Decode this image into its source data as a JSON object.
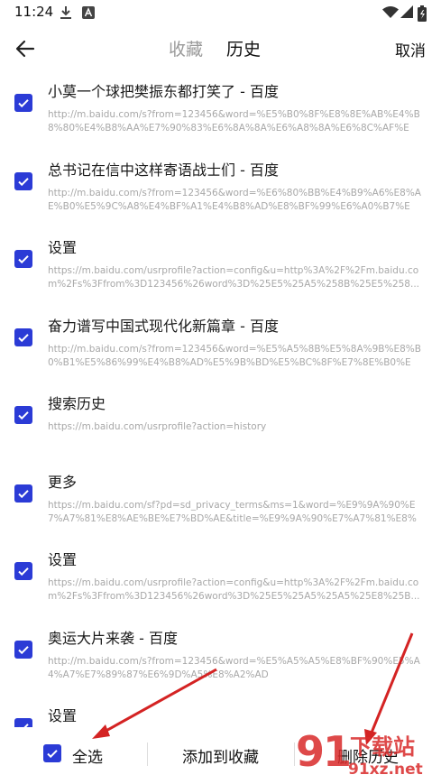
{
  "status_bar": {
    "time": "11:24"
  },
  "header": {
    "tab_favorites": "收藏",
    "tab_history": "历史",
    "cancel": "取消"
  },
  "items": [
    {
      "title": "小莫一个球把樊振东都打笑了 - 百度",
      "url": "http://m.baidu.com/s?from=123456&word=%E5%B0%8F%E8%8E%AB%E4%B8%80%E4%B8%AA%E7%90%83%E6%8A%8A%E6%A8%8A%E6%8C%AF%E4%B8..."
    },
    {
      "title": "总书记在信中这样寄语战士们 - 百度",
      "url": "http://m.baidu.com/s?from=123456&word=%E6%80%BB%E4%B9%A6%E8%AE%B0%E5%9C%A8%E4%BF%A1%E4%B8%AD%E8%BF%99%E6%A0%B7%E5%AF..."
    },
    {
      "title": "设置",
      "url": "https://m.baidu.com/usrprofile?action=config&u=http%3A%2F%2Fm.baidu.com%2Fs%3Ffrom%3D123456%26word%3D%25E5%25A5%258B%25E5%258..."
    },
    {
      "title": "奋力谱写中国式现代化新篇章 - 百度",
      "url": "http://m.baidu.com/s?from=123456&word=%E5%A5%8B%E5%8A%9B%E8%B0%B1%E5%86%99%E4%B8%AD%E5%9B%BD%E5%BC%8F%E7%8E%B0%E4%BB..."
    },
    {
      "title": "搜索历史",
      "url": "https://m.baidu.com/usrprofile?action=history"
    },
    {
      "title": "更多",
      "url": "https://m.baidu.com/sf?pd=sd_privacy_terms&ms=1&word=%E9%9A%90%E7%A7%81%E8%AE%BE%E7%BD%AE&title=%E9%9A%90%E7%A7%81%E8%AE%..."
    },
    {
      "title": "设置",
      "url": "https://m.baidu.com/usrprofile?action=config&u=http%3A%2F%2Fm.baidu.com%2Fs%3Ffrom%3D123456%26word%3D%25E5%25A5%25A5%25E8%25B..."
    },
    {
      "title": "奥运大片来袭 - 百度",
      "url": "http://m.baidu.com/s?from=123456&word=%E5%A5%A5%E8%BF%90%E5%A4%A7%E7%89%87%E6%9D%A5%E8%A2%AD"
    },
    {
      "title": "设置",
      "url": ""
    }
  ],
  "bottom_bar": {
    "select_all": "全选",
    "add_to_favorites": "添加到收藏",
    "delete_history": "删除历史"
  },
  "watermark": {
    "number": "91",
    "brand": "下载站",
    "site": "91xz.net"
  },
  "colors": {
    "checkbox": "#2b3bd6",
    "arrow": "#d42323"
  },
  "icons": [
    "download-icon",
    "font-a-icon",
    "wifi-icon",
    "signal-icon",
    "battery-icon",
    "arrow-left-icon",
    "check-icon"
  ]
}
